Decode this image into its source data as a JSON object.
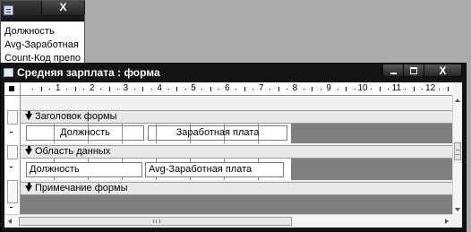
{
  "field_list": {
    "close_label": "X",
    "fields": [
      "Должность",
      "Avg-Заработная",
      "Count-Код препо"
    ]
  },
  "form_window": {
    "title": "Средняя зарплата : форма",
    "close_label": "X"
  },
  "ruler": {
    "numbers": [
      "1",
      "2",
      "3",
      "4",
      "5",
      "6",
      "7",
      "8",
      "9",
      "10",
      "11",
      "12"
    ]
  },
  "sections": {
    "header": {
      "label": "Заголовок формы",
      "controls": [
        "Должность",
        "Заработная плата"
      ]
    },
    "detail": {
      "label": "Область данных",
      "controls": [
        "Должность",
        "Avg-Заработная плата"
      ]
    },
    "footer": {
      "label": "Примечание формы"
    }
  },
  "colors": {
    "titlebar": "#141414",
    "grid_line": "#8a8a8a",
    "out_of_form_area": "#7f7f7f"
  }
}
